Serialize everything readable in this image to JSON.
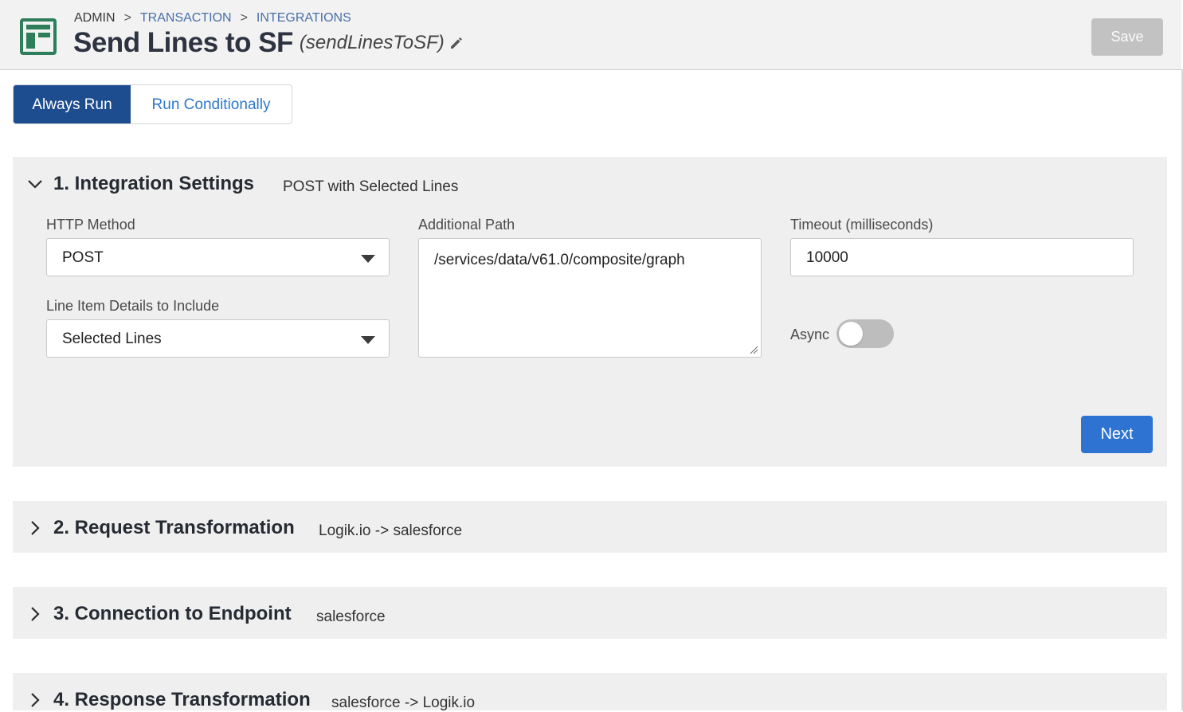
{
  "header": {
    "breadcrumb": [
      "ADMIN",
      "TRANSACTION",
      "INTEGRATIONS"
    ],
    "breadcrumb_separator": ">",
    "title": "Send Lines to SF",
    "subtitle": "(sendLinesToSF)",
    "save_label": "Save",
    "app_icon": "table-layout-icon",
    "edit_icon": "pencil-icon"
  },
  "run_mode": {
    "options": [
      "Always Run",
      "Run Conditionally"
    ],
    "selected": "Always Run"
  },
  "sections": [
    {
      "title": "1. Integration Settings",
      "summary": "POST with Selected Lines",
      "expanded": true
    },
    {
      "title": "2. Request Transformation",
      "summary": "Logik.io -> salesforce",
      "expanded": false
    },
    {
      "title": "3. Connection to Endpoint",
      "summary": "salesforce",
      "expanded": false
    },
    {
      "title": "4. Response Transformation",
      "summary": "salesforce -> Logik.io",
      "expanded": false
    }
  ],
  "settings": {
    "http_method_label": "HTTP Method",
    "http_method_value": "POST",
    "line_items_label": "Line Item Details to Include",
    "line_items_value": "Selected Lines",
    "path_label": "Additional Path",
    "path_value": "/services/data/v61.0/composite/graph",
    "timeout_label": "Timeout (milliseconds)",
    "timeout_value": "10000",
    "async_label": "Async",
    "async_on": false,
    "next_label": "Next"
  },
  "colors": {
    "primary": "#1d4c8f",
    "accent_blue": "#2f73d2",
    "link_blue": "#2e77c9",
    "icon_green": "#2e7d5b",
    "disabled_gray": "#c2c2c2"
  }
}
